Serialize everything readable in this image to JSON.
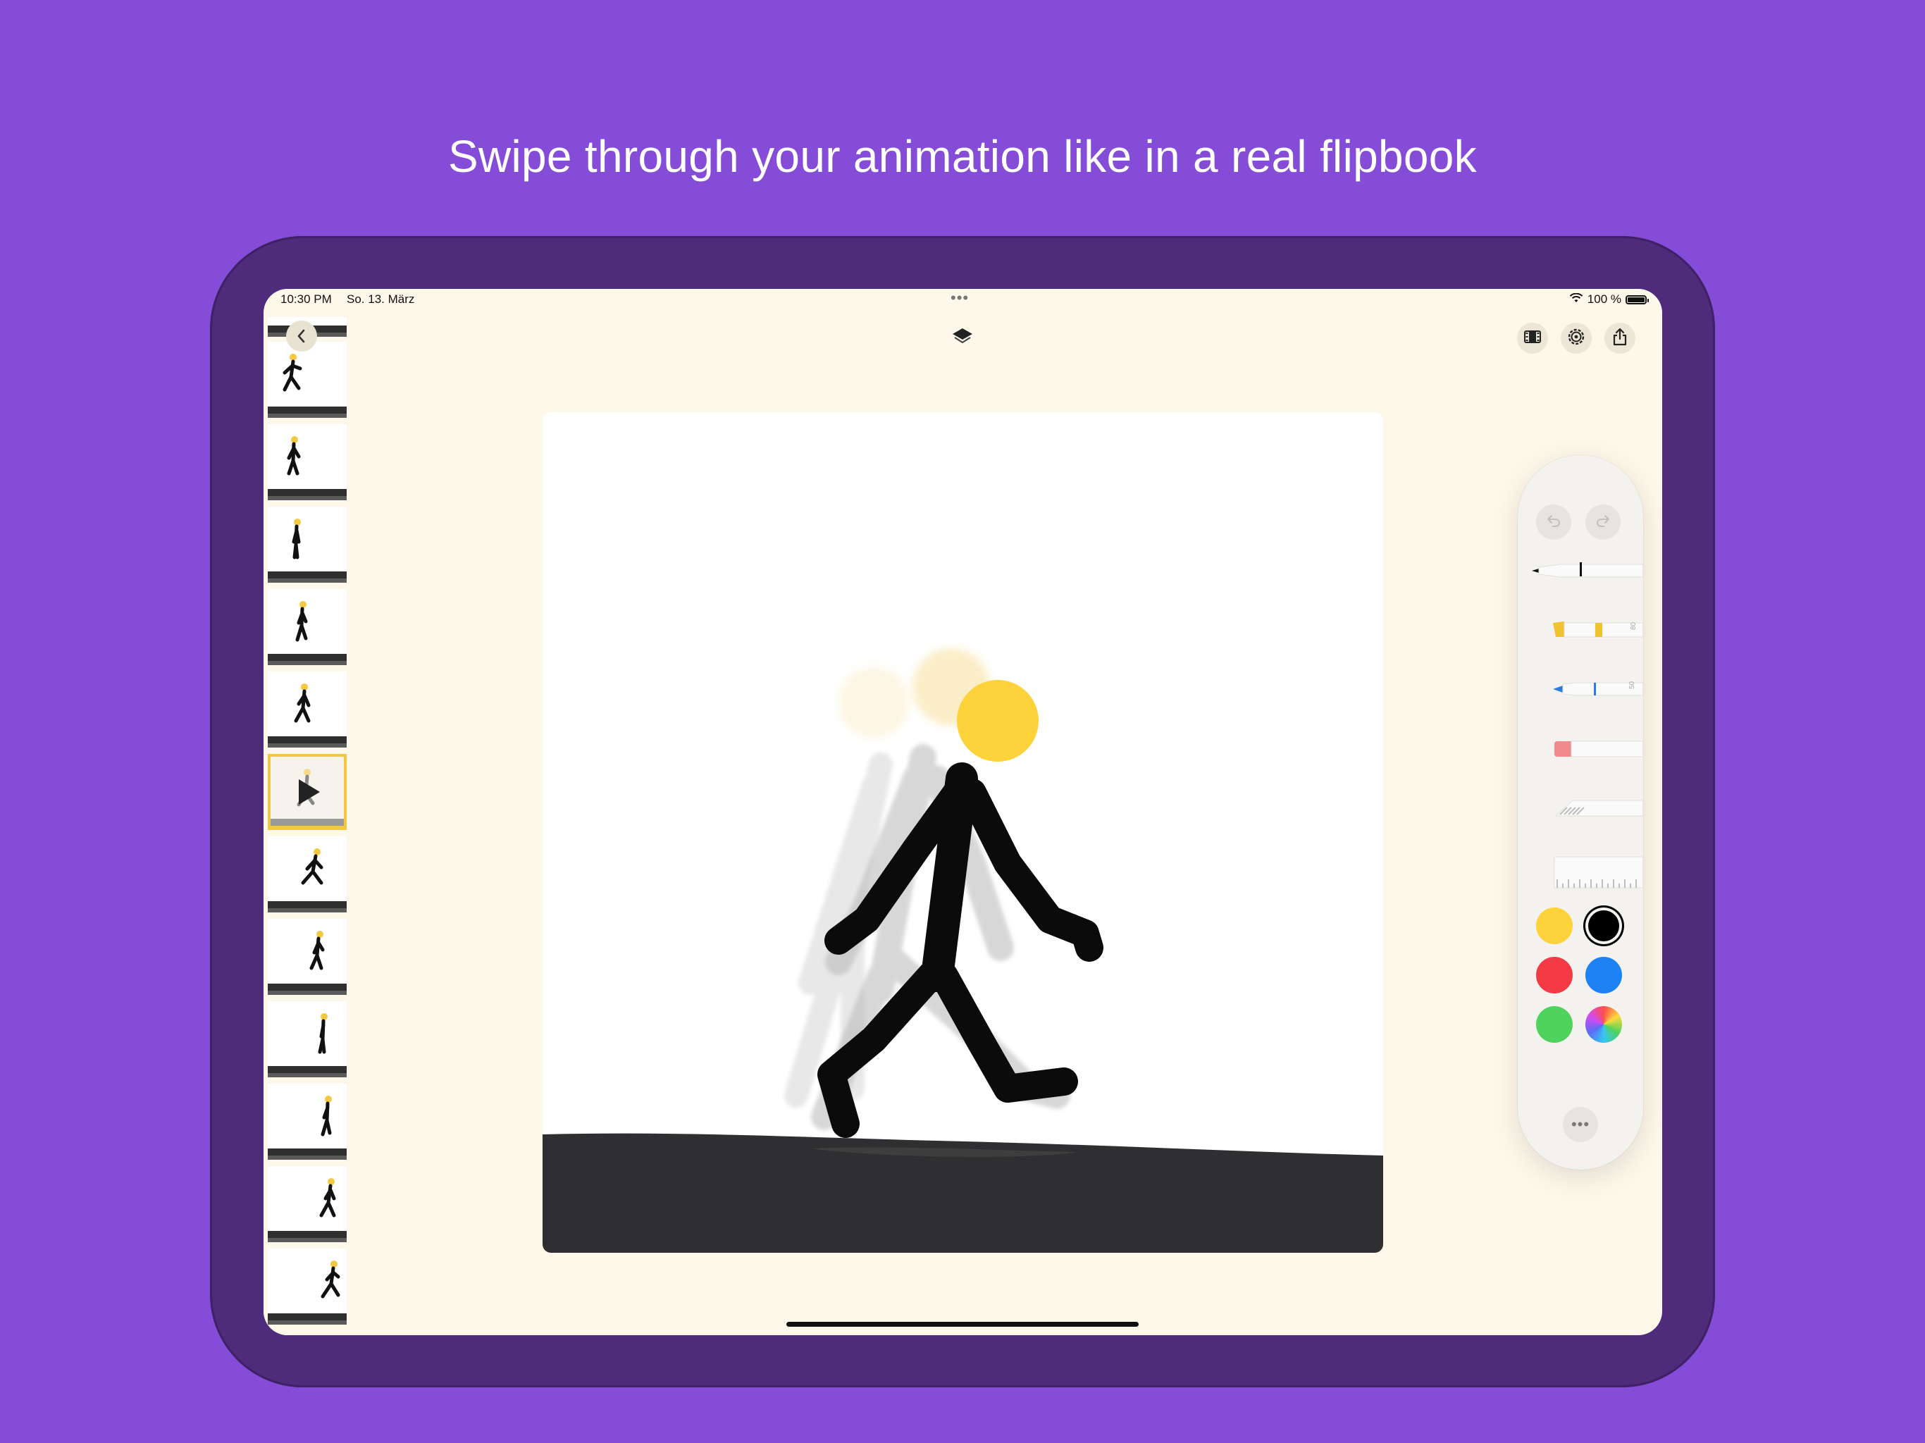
{
  "headline": "Swipe through your animation like in a real flipbook",
  "status_bar": {
    "time": "10:30 PM",
    "date": "So. 13. März",
    "center_dots": "•••",
    "battery_text": "100 %"
  },
  "icons": {
    "back": "chevron-left-icon",
    "layers": "layers-icon",
    "film": "film-strip-icon",
    "settings": "settings-gear-icon",
    "share": "share-icon",
    "undo": "undo-icon",
    "redo": "redo-icon",
    "more": "ellipsis-icon"
  },
  "tools": {
    "pen": "pen-tool",
    "marker": "marker-tool",
    "marker_size": "80",
    "pencil": "pencil-tool",
    "pencil_size": "50",
    "eraser": "eraser-tool",
    "lasso": "lasso-tool",
    "ruler": "ruler-tool",
    "more_label": "•••"
  },
  "colors": {
    "selected": "#000000",
    "swatches": [
      "#fdd23a",
      "#000000",
      "#f43b45",
      "#1e82f5",
      "#4fd35e",
      "multicolor"
    ]
  },
  "filmstrip": {
    "frame_count": 12,
    "selected_frame": 6
  }
}
